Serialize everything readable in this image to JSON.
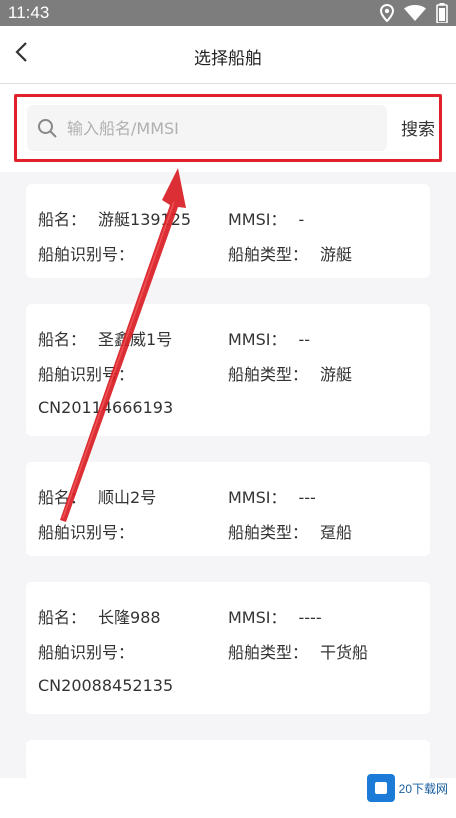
{
  "status_bar": {
    "time": "11:43"
  },
  "header": {
    "title": "选择船舶"
  },
  "search": {
    "placeholder": "输入船名/MMSI",
    "value": "",
    "button_label": "搜索"
  },
  "ships": [
    {
      "name_label": "船名：",
      "name": "游艇139125",
      "mmsi_label": "MMSI：",
      "mmsi": "-",
      "id_label": "船舶识别号：",
      "id": "",
      "type_label": "船舶类型：",
      "type": "游艇"
    },
    {
      "name_label": "船名：",
      "name": "圣鑫威1号",
      "mmsi_label": "MMSI：",
      "mmsi": "--",
      "id_label": "船舶识别号：",
      "id": "CN20114666193",
      "type_label": "船舶类型：",
      "type": "游艇"
    },
    {
      "name_label": "船名：",
      "name": "顺山2号",
      "mmsi_label": "MMSI：",
      "mmsi": "---",
      "id_label": "船舶识别号：",
      "id": "",
      "type_label": "船舶类型：",
      "type": "趸船"
    },
    {
      "name_label": "船名：",
      "name": "长隆988",
      "mmsi_label": "MMSI：",
      "mmsi": "----",
      "id_label": "船舶识别号：",
      "id": "CN20088452135",
      "type_label": "船舶类型：",
      "type": "干货船"
    }
  ],
  "watermark": {
    "text": "20下载网"
  },
  "colors": {
    "highlight": "#e0202a",
    "status_bar": "#7d7d7d",
    "background": "#f5f5f7"
  }
}
